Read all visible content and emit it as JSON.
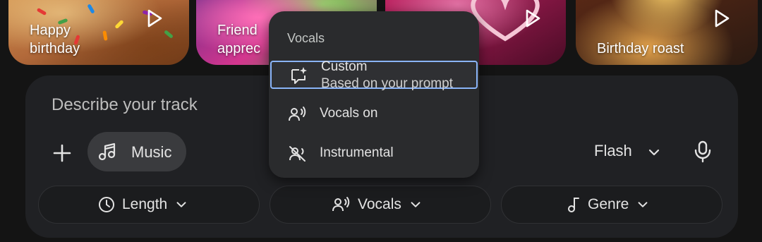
{
  "cards": [
    {
      "label": "Happy\nbirthday"
    },
    {
      "label": "Friend\napprec"
    },
    {
      "label": ""
    },
    {
      "label": "Birthday roast"
    }
  ],
  "composer": {
    "placeholder": "Describe your track",
    "mode_chip": {
      "label": "Music",
      "icon": "music-note-icon"
    },
    "model": {
      "label": "Flash"
    },
    "options": [
      {
        "label": "Length",
        "icon": "clock-icon"
      },
      {
        "label": "Vocals",
        "icon": "voice-icon"
      },
      {
        "label": "Genre",
        "icon": "music-note-icon"
      }
    ]
  },
  "menu": {
    "title": "Vocals",
    "items": [
      {
        "label": "Custom",
        "sublabel": "Based on your prompt",
        "icon": "custom-prompt-icon",
        "selected": true
      },
      {
        "label": "Vocals on",
        "icon": "voice-icon"
      },
      {
        "label": "Instrumental",
        "icon": "voice-off-icon"
      }
    ]
  },
  "colors": {
    "background": "#141414",
    "panel": "#202124",
    "menu": "#2a2b2d",
    "focus_outline": "#8ab4f8",
    "text": "#e3e3e3"
  }
}
